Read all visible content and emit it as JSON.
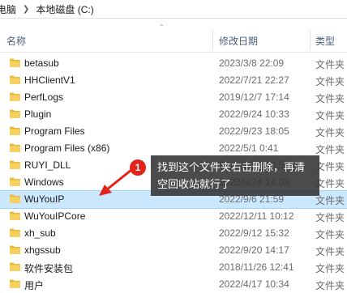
{
  "breadcrumb": {
    "parent": "电脑",
    "current": "本地磁盘 (C:)"
  },
  "columns": {
    "name": "名称",
    "date": "修改日期",
    "type": "类型"
  },
  "colors": {
    "folder": "#f7d160",
    "selection": "#cce8ff",
    "badge": "#e2231a",
    "callout_bg": "#323232"
  },
  "rows": [
    {
      "name": "betasub",
      "date": "2023/3/8 22:09",
      "type": "文件夹"
    },
    {
      "name": "HHClientV1",
      "date": "2022/7/21 22:27",
      "type": "文件夹"
    },
    {
      "name": "PerfLogs",
      "date": "2019/12/7 17:14",
      "type": "文件夹"
    },
    {
      "name": "Plugin",
      "date": "2022/9/24 10:33",
      "type": "文件夹"
    },
    {
      "name": "Program Files",
      "date": "2022/9/23 18:05",
      "type": "文件夹"
    },
    {
      "name": "Program Files (x86)",
      "date": "2022/5/1 0:41",
      "type": "文件夹"
    },
    {
      "name": "RUYI_DLL",
      "date": "2022/8/26 10:57",
      "type": "文件夹"
    },
    {
      "name": "Windows",
      "date": "2022/9/24 14:03",
      "type": "文件夹"
    },
    {
      "name": "WuYouIP",
      "date": "2022/9/6 21:59",
      "type": "文件夹",
      "selected": true
    },
    {
      "name": "WuYouIPCore",
      "date": "2022/12/11 10:12",
      "type": "文件夹"
    },
    {
      "name": "xh_sub",
      "date": "2022/9/12 15:32",
      "type": "文件夹"
    },
    {
      "name": "xhgssub",
      "date": "2022/9/20 14:17",
      "type": "文件夹"
    },
    {
      "name": "软件安装包",
      "date": "2018/11/26 12:41",
      "type": "文件夹"
    },
    {
      "name": "用户",
      "date": "2022/4/17 10:34",
      "type": "文件夹"
    }
  ],
  "annotation": {
    "badge": "1",
    "text_line1": "找到这个文件夹右击删除，再清",
    "text_line2": "空回收站就行了"
  }
}
